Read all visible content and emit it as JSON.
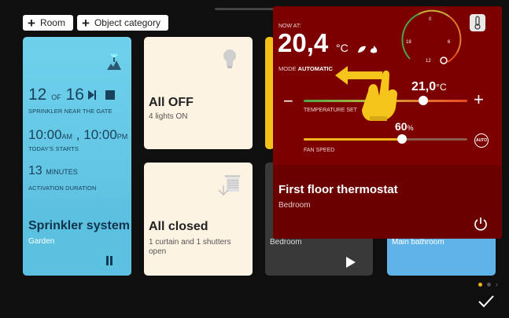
{
  "toolbar": {
    "room_label": "Room",
    "object_category_label": "Object category"
  },
  "sprinkler": {
    "start_time_1": "12",
    "of_label": "OF",
    "start_time_2": "16",
    "location_label": "SPRINKLER NEAR THE GATE",
    "time_1": "10:00",
    "time_1_suffix": "AM",
    "time_sep": ",",
    "time_2": "10:00",
    "time_2_suffix": "PM",
    "starts_label": "TODAY'S STARTS",
    "duration_value": "13",
    "duration_unit": "MINUTES",
    "duration_label": "ACTIVATION DURATION",
    "title": "Sprinkler system",
    "place": "Garden"
  },
  "lights": {
    "title": "All OFF",
    "subtitle": "4 lights ON"
  },
  "shutters": {
    "title": "All closed",
    "subtitle": "1 curtain and 1 shutters open"
  },
  "dark_card": {
    "room": "Bedroom"
  },
  "blue_card": {
    "room": "Main bathroom"
  },
  "thermostat": {
    "now_label": "NOW AT:",
    "current_temp": "20,4",
    "unit": "°C",
    "mode_label": "MODE",
    "mode_value": "AUTOMATIC",
    "set_temp": "21,0",
    "set_unit": "°C",
    "temperature_label": "TEMPERATURE SET",
    "fan_value": "60",
    "fan_unit": "%",
    "fan_label": "FAN SPEED",
    "auto_label": "AUTO",
    "dial_labels": [
      "0",
      "6",
      "12",
      "18"
    ],
    "name": "First floor thermostat",
    "room": "Bedroom",
    "set_level": 0.73,
    "fan_level": 0.6
  },
  "pagination": {
    "pages": 2,
    "active": 0
  },
  "colors": {
    "sprinkler": "#62c5e3",
    "thermostat": "#7a0000",
    "accent": "#f2b61c"
  }
}
